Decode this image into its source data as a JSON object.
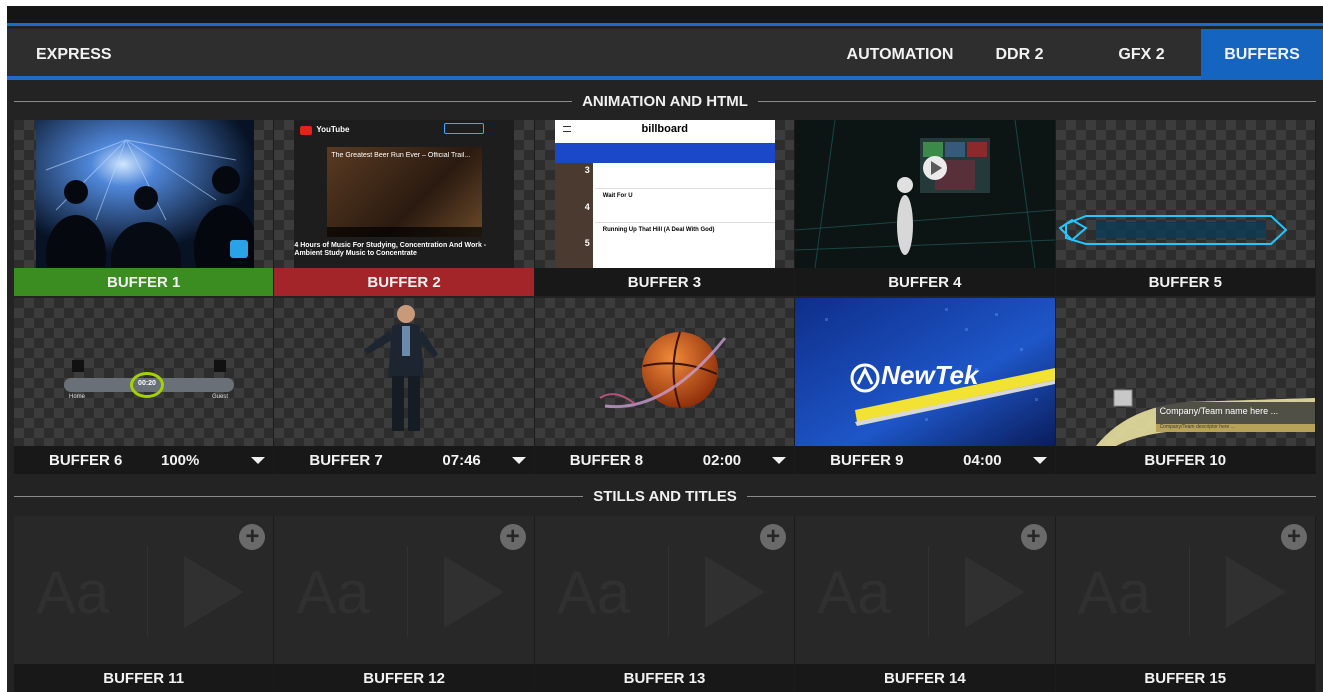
{
  "tabs": {
    "left": "EXPRESS",
    "right": [
      "AUTOMATION",
      "DDR 2",
      "GFX 2",
      "BUFFERS"
    ],
    "active": "BUFFERS"
  },
  "sections": {
    "animation": "ANIMATION AND HTML",
    "stills": "STILLS AND TITLES"
  },
  "buffers": {
    "b1": {
      "label": "BUFFER 1",
      "status": "green"
    },
    "b2": {
      "label": "BUFFER 2",
      "status": "red"
    },
    "b3": {
      "label": "BUFFER 3"
    },
    "b4": {
      "label": "BUFFER 4"
    },
    "b5": {
      "label": "BUFFER 5"
    },
    "b6": {
      "label": "BUFFER 6",
      "value": "100%"
    },
    "b7": {
      "label": "BUFFER 7",
      "value": "07:46"
    },
    "b8": {
      "label": "BUFFER 8",
      "value": "02:00"
    },
    "b9": {
      "label": "BUFFER 9",
      "value": "04:00"
    },
    "b10": {
      "label": "BUFFER 10"
    },
    "b11": {
      "label": "BUFFER 11"
    },
    "b12": {
      "label": "BUFFER 12"
    },
    "b13": {
      "label": "BUFFER 13"
    },
    "b14": {
      "label": "BUFFER 14"
    },
    "b15": {
      "label": "BUFFER 15"
    }
  },
  "thumb_text": {
    "youtube_brand": "YouTube",
    "youtube_video_title": "The Greatest Beer Run Ever – Official Trail...",
    "youtube_caption": "4 Hours of Music For Studying, Concentration And Work - Ambient Study Music to Concentrate",
    "billboard_brand": "billboard",
    "billboard_rank_3": "3",
    "billboard_rank_4": "4",
    "billboard_rank_5": "5",
    "billboard_song_4": "Wait For U",
    "billboard_song_5": "Running Up That Hill (A Deal With God)",
    "newtek_logo": "NewTek",
    "scoreboard_clock": "00:20",
    "scoreboard_home": "Home",
    "scoreboard_guest": "Guest",
    "lower_third_name": "Company/Team name here ...",
    "lower_third_sub": "Company/Team descriptor here ...",
    "stills_placeholder": "Aa"
  },
  "colors": {
    "accent": "#1565c0",
    "live_green": "#3b8d22",
    "preview_red": "#a3252a"
  }
}
